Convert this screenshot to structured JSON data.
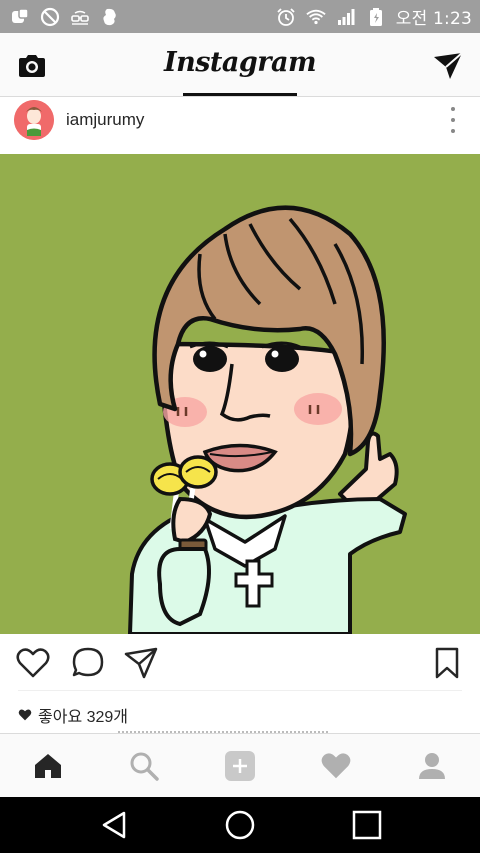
{
  "status_bar": {
    "left_icons": [
      "media-icon",
      "do-not-disturb-icon",
      "glasses-icon",
      "app-icon"
    ],
    "right_icons": [
      "alarm-icon",
      "wifi-icon",
      "signal-icon",
      "battery-icon"
    ],
    "time": "오전 1:23"
  },
  "header": {
    "title": "Instagram",
    "left_icon": "camera-icon",
    "right_icon": "direct-message-icon"
  },
  "post": {
    "username": "iamjurumy",
    "avatar": "profile-avatar",
    "image_description_icon": "caricature-illustration",
    "likes_text": "좋아요 329개",
    "actions": [
      "heart-icon",
      "comment-icon",
      "share-icon"
    ],
    "save_icon": "bookmark-icon"
  },
  "tab_bar": {
    "items": [
      "home-icon",
      "search-icon",
      "add-icon",
      "activity-heart-icon",
      "profile-icon"
    ],
    "active": "home-icon"
  },
  "nav_bar": {
    "items": [
      "back-icon",
      "home-circle-icon",
      "recents-icon"
    ]
  },
  "colors": {
    "status_bar_bg": "#9e9e9e",
    "image_bg": "#94ae4c",
    "nav_bar_bg": "#000000"
  }
}
